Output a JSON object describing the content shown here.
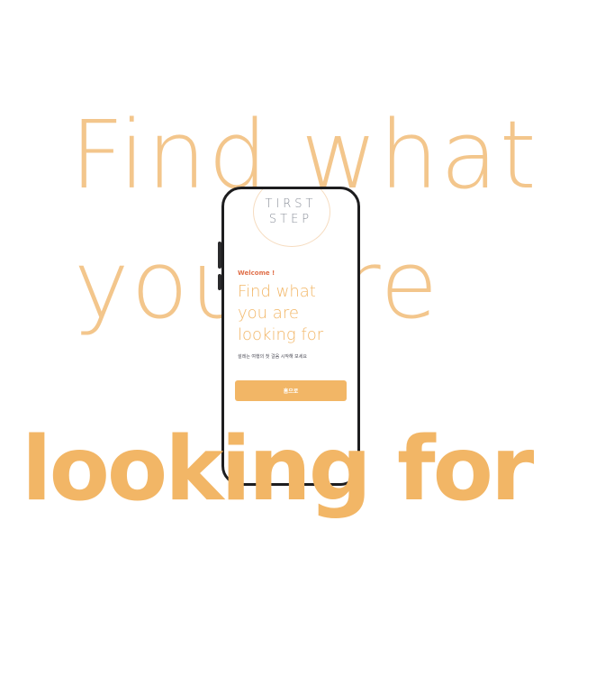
{
  "background": {
    "line1": "Find what",
    "line2": "you are",
    "line3": "looking for"
  },
  "phone": {
    "logo": {
      "line1": "TIRST",
      "line2": "STEP"
    },
    "welcome": "Welcome !",
    "headline": {
      "line1": "Find what",
      "line2": "you are",
      "line3": "looking for"
    },
    "subtitle": "설레는 여행의 첫 걸음 시작해 보세요",
    "cta_label": "홈으로"
  },
  "colors": {
    "accent": "#f2b666",
    "accent_light": "#f3c68c",
    "welcome": "#e0704a",
    "phone_frame": "#1d1d1f"
  }
}
